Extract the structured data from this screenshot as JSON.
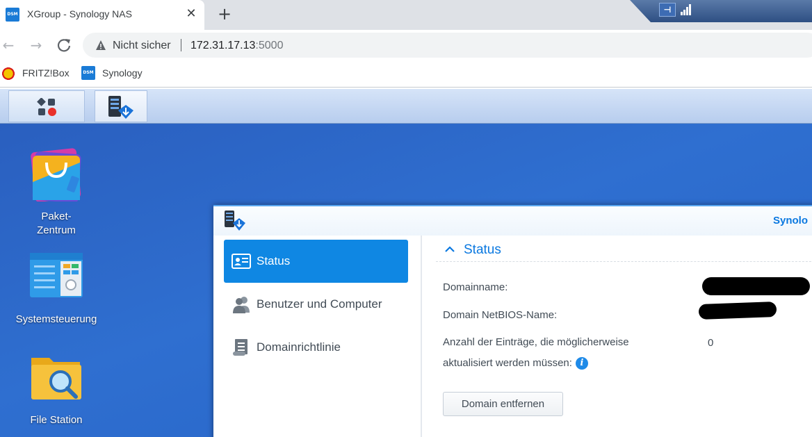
{
  "browser": {
    "tab_title": "XGroup - Synology NAS",
    "tab_favicon_text": "DSM",
    "close_glyph": "✕",
    "new_tab_glyph": "+",
    "security_label": "Nicht sicher",
    "url_host": "172.31.17.13",
    "url_port": ":5000",
    "bookmarks": [
      {
        "label": "FRITZ!Box",
        "icon": "fritzbox-icon"
      },
      {
        "label": "Synology",
        "icon": "synology-dsm-icon",
        "icon_text": "DSM"
      }
    ]
  },
  "dsm": {
    "desktop_icons": [
      {
        "label_line1": "Paket-",
        "label_line2": "Zentrum",
        "icon": "package-center-icon"
      },
      {
        "label": "Systemsteuerung",
        "icon": "control-panel-icon"
      },
      {
        "label": "File Station",
        "icon": "file-station-icon"
      }
    ],
    "window": {
      "title": "Synolo",
      "sidebar": [
        {
          "label": "Status",
          "icon": "status-card-icon",
          "active": true
        },
        {
          "label": "Benutzer und Computer",
          "icon": "users-icon",
          "active": false
        },
        {
          "label": "Domainrichtlinie",
          "icon": "policy-document-icon",
          "active": false
        }
      ],
      "section_title": "Status",
      "rows": [
        {
          "label": "Domainname:",
          "value": ""
        },
        {
          "label": "Domain NetBIOS-Name:",
          "value": ""
        },
        {
          "label_line1": "Anzahl der Einträge, die möglicherweise",
          "label_line2": "aktualisiert werden müssen:",
          "value": "0"
        }
      ],
      "info_glyph": "i",
      "remove_button": "Domain entfernen"
    }
  },
  "colors": {
    "accent": "#0f87e3",
    "title_blue": "#0a78e0",
    "desktop_blue": "#2f6fd0"
  }
}
